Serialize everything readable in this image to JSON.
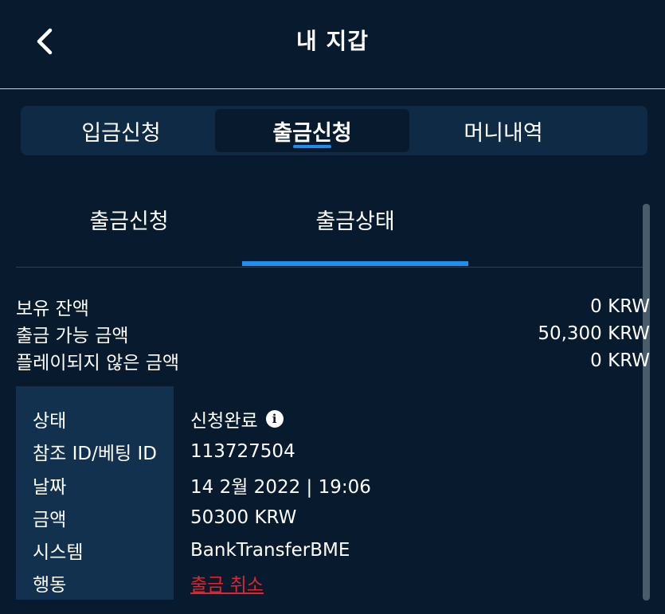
{
  "header": {
    "title": "내 지갑",
    "back_icon": "chevron-left-icon"
  },
  "top_tabs": [
    {
      "label": "입금신청",
      "active": false
    },
    {
      "label": "출금신청",
      "active": true
    },
    {
      "label": "머니내역",
      "active": false
    }
  ],
  "sub_tabs": [
    {
      "label": "출금신청",
      "active": false
    },
    {
      "label": "출금상태",
      "active": true
    }
  ],
  "summary": [
    {
      "label": "보유 잔액",
      "value": "0 KRW"
    },
    {
      "label": "출금 가능 금액",
      "value": "50,300 KRW"
    },
    {
      "label": "플레이되지 않은 금액",
      "value": "0 KRW"
    }
  ],
  "details": {
    "status": {
      "label": "상태",
      "value": "신청완료"
    },
    "reference": {
      "label": "참조 ID/베팅 ID",
      "value": "113727504"
    },
    "date": {
      "label": "날짜",
      "value": "14 2월 2022 | 19:06"
    },
    "amount": {
      "label": "금액",
      "value": "50300 KRW"
    },
    "system": {
      "label": "시스템",
      "value": "BankTransferBME"
    },
    "action": {
      "label": "행동",
      "value": "출금 취소"
    }
  },
  "colors": {
    "background": "#081a2e",
    "tab_bar": "#0f2a45",
    "accent": "#1e8ff0",
    "panel": "#12314f",
    "danger": "#e8222a"
  }
}
